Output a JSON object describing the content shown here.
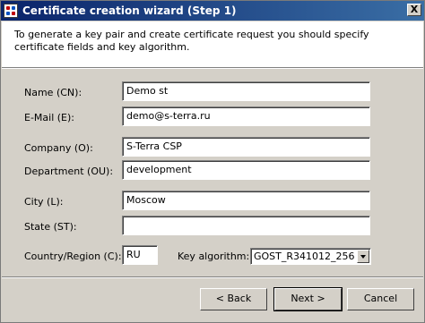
{
  "window": {
    "title": "Certificate creation wizard (Step 1)",
    "close_glyph": "X"
  },
  "description": "To generate a key pair and create certificate request you should specify certificate fields and key algorithm.",
  "fields": {
    "name": {
      "label": "Name (CN):",
      "value": "Demo st"
    },
    "email": {
      "label": "E-Mail (E):",
      "value": "demo@s-terra.ru"
    },
    "company": {
      "label": "Company (O):",
      "value": "S-Terra CSP"
    },
    "department": {
      "label": "Department (OU):",
      "value": "development"
    },
    "city": {
      "label": "City (L):",
      "value": "Moscow"
    },
    "state": {
      "label": "State (ST):",
      "value": ""
    },
    "country": {
      "label": "Country/Region (C):",
      "value": "RU"
    }
  },
  "key_algorithm": {
    "label": "Key algorithm:",
    "value": "GOST_R341012_256"
  },
  "buttons": {
    "back": "< Back",
    "next": "Next >",
    "cancel": "Cancel"
  }
}
